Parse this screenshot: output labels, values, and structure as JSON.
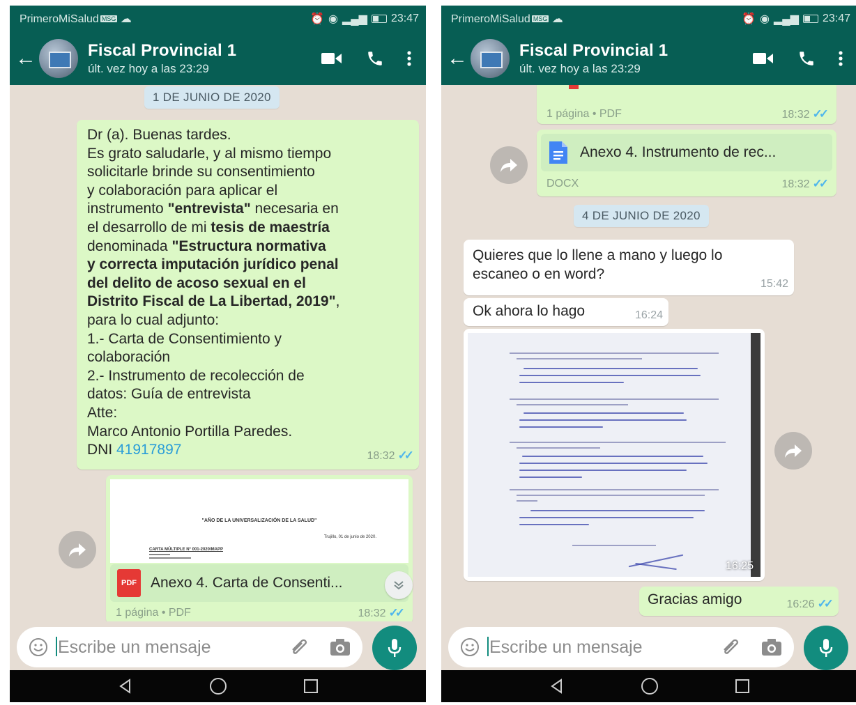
{
  "left": {
    "status": {
      "carrier": "PrimeroMiSalud",
      "badge": "MSG",
      "time": "23:47"
    },
    "header": {
      "contact": "Fiscal Provincial 1",
      "last_seen": "últ. vez hoy a las 23:29"
    },
    "date_chip": "1 DE JUNIO DE 2020",
    "message": {
      "line1": "Dr (a). Buenas tardes.",
      "line2": "Es grato saludarle, y al mismo tiempo",
      "line3": "solicitarle brinde su consentimiento",
      "line4": "y colaboración para aplicar el",
      "line5a": "instrumento ",
      "line5b": "\"entrevista\"",
      "line5c": " necesaria en",
      "line6a": "el desarrollo de mi ",
      "line6b": "tesis de maestría",
      "line7a": "denominada ",
      "line7b": "\"Estructura normativa",
      "line8": "y correcta imputación jurídico penal",
      "line9": "del delito de acoso sexual en el",
      "line10a": "Distrito Fiscal de La Libertad, 2019\"",
      "line10b": ",",
      "line11": "para lo cual adjunto:",
      "line12": "1.- Carta de Consentimiento y",
      "line13": "colaboración",
      "line14": "2.- Instrumento de recolección de",
      "line15": "datos: Guía de entrevista",
      "line16": "Atte:",
      "line17": "Marco Antonio Portilla Paredes.",
      "line18a": "DNI ",
      "line18b": "41917897",
      "time": "18:32"
    },
    "pdf_preview": {
      "heading": "\"AÑO DE LA UNIVERSALIZACIÓN DE LA SALUD\"",
      "date": "Trujillo, 01 de junio de 2020.",
      "ref": "CARTA MÚLTIPLE N° 001-2020/MAPP"
    },
    "doc": {
      "icon_label": "PDF",
      "name": "Anexo 4. Carta de Consenti...",
      "meta": "1 página • PDF",
      "time": "18:32"
    },
    "input_placeholder": "Escribe un mensaje"
  },
  "right": {
    "status": {
      "carrier": "PrimeroMiSalud",
      "badge": "MSG",
      "time": "23:47"
    },
    "header": {
      "contact": "Fiscal Provincial 1",
      "last_seen": "últ. vez hoy a las 23:29"
    },
    "top_doc_meta": {
      "meta": "1 página • PDF",
      "time": "18:32"
    },
    "docx": {
      "name": "Anexo 4. Instrumento de rec...",
      "meta": "DOCX",
      "time": "18:32"
    },
    "date_chip": "4 DE JUNIO DE 2020",
    "msg1": {
      "line1": "Quieres que lo llene a mano y luego lo",
      "line2": "escaneo o en word?",
      "time": "15:42"
    },
    "msg2": {
      "text": "Ok ahora lo hago",
      "time": "16:24"
    },
    "photo": {
      "time": "16:25"
    },
    "msg3": {
      "text": "Gracias amigo",
      "time": "16:26"
    },
    "input_placeholder": "Escribe un mensaje"
  },
  "colors": {
    "header": "#075e54",
    "accent": "#128c7e",
    "outgoing": "#dcf8c6",
    "incoming": "#ffffff",
    "chat_bg": "#e6ddd4",
    "ticks": "#4fb6ec"
  }
}
